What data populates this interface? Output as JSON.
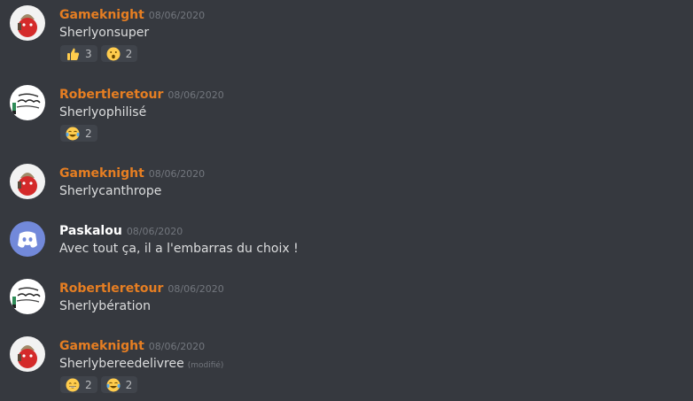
{
  "messages": [
    {
      "username": "Gameknight",
      "timestamp": "08/06/2020",
      "content": "Sherlyonsuper",
      "avatar": "gameknight-avatar",
      "reactions": [
        {
          "emoji": "thumbs-up",
          "count": "3"
        },
        {
          "emoji": "surprised-face",
          "count": "2"
        }
      ]
    },
    {
      "username": "Robertleretour",
      "timestamp": "08/06/2020",
      "content": "Sherlyophilisé",
      "avatar": "robertleretour-avatar",
      "reactions": [
        {
          "emoji": "tears-of-joy",
          "count": "2"
        }
      ]
    },
    {
      "username": "Gameknight",
      "timestamp": "08/06/2020",
      "content": "Sherlycanthrope",
      "avatar": "gameknight-avatar"
    },
    {
      "username": "Paskalou",
      "timestamp": "08/06/2020",
      "content": "Avec tout ça, il a l'embarras du choix !",
      "avatar": "discord-default-avatar"
    },
    {
      "username": "Robertleretour",
      "timestamp": "08/06/2020",
      "content": "Sherlybération",
      "avatar": "robertleretour-avatar"
    },
    {
      "username": "Gameknight",
      "timestamp": "08/06/2020",
      "content": "Sherlybereedelivree",
      "edited": "(modifié)",
      "avatar": "gameknight-avatar",
      "reactions": [
        {
          "emoji": "grinning-face",
          "count": "2"
        },
        {
          "emoji": "tears-of-joy",
          "count": "2"
        }
      ]
    }
  ],
  "colors": {
    "background": "#36393f",
    "username_orange": "#e67e22",
    "username_white": "#ffffff",
    "text": "#dcddde",
    "muted": "#72767d",
    "reaction_bg": "#40444b"
  }
}
